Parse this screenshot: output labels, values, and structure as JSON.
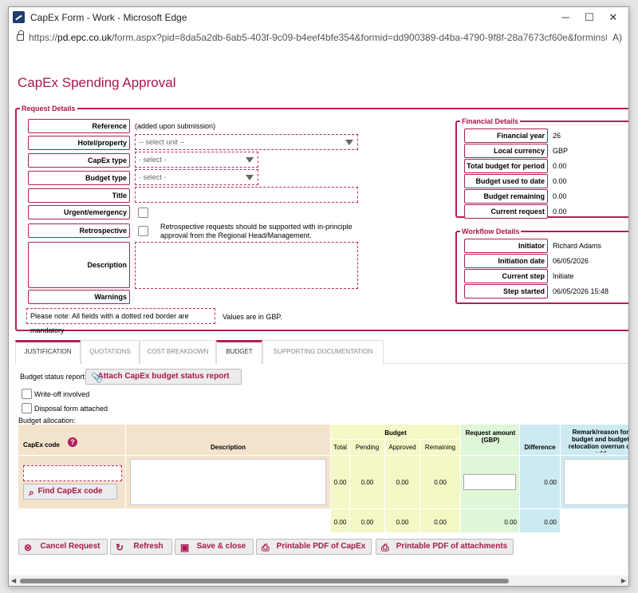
{
  "window": {
    "title": "CapEx Form - Work - Microsoft Edge",
    "minimize": "─",
    "maximize": "☐",
    "close": "✕"
  },
  "address": {
    "protocol": "https://",
    "host": "pd.epc.co.uk",
    "path": "/form.aspx?pid=8da5a2db-6ab5-403f-9c09-b4eef4bfe354&formid=dd900389-d4ba-4790-9f8f-28a7673cf60e&forminstid=&wfi...",
    "read_aloud": "A)"
  },
  "page": {
    "title": "CapEx Spending Approval"
  },
  "request": {
    "legend": "Request Details",
    "labels": {
      "reference": "Reference",
      "hotel": "Hotel/property",
      "capex_type": "CapEx type",
      "budget_type": "Budget type",
      "title": "Title",
      "urgent": "Urgent/emergency",
      "retrospective": "Retrospective",
      "description": "Description",
      "warnings": "Warnings"
    },
    "reference_value": "(added upon submission)",
    "hotel_placeholder": "-- select unit --",
    "capex_type_placeholder": "- select -",
    "budget_type_placeholder": "- select -",
    "retro_note": "Retrospective requests should be supported with in-principle approval from the Regional Head/Management.",
    "mandatory_note": "Please note: All fields with a dotted red border are mandatory",
    "currency_note": "Values are in GBP."
  },
  "financial": {
    "legend": "Financial Details",
    "rows": [
      {
        "label": "Financial year",
        "value": "26"
      },
      {
        "label": "Local currency",
        "value": "GBP"
      },
      {
        "label": "Total budget for period",
        "value": "0.00"
      },
      {
        "label": "Budget used to date",
        "value": "0.00"
      },
      {
        "label": "Budget remaining",
        "value": "0.00"
      },
      {
        "label": "Current request",
        "value": "0.00"
      }
    ]
  },
  "workflow": {
    "legend": "Workflow Details",
    "rows": [
      {
        "label": "Initiator",
        "value": "Richard Adams"
      },
      {
        "label": "Initiation date",
        "value": "06/05/2026"
      },
      {
        "label": "Current step",
        "value": "Initiate"
      },
      {
        "label": "Step started",
        "value": "06/05/2026 15:48"
      }
    ]
  },
  "tabs": [
    "JUSTIFICATION",
    "QUOTATIONS",
    "COST BREAKDOWN",
    "BUDGET",
    "SUPPORTING DOCUMENTATION"
  ],
  "budget_section": {
    "status_label": "Budget status report:",
    "attach_button": "Attach CapEx budget status report",
    "writeoff_label": "Write-off involved",
    "disposal_label": "Disposal form attached",
    "allocation_label": "Budget allocation:",
    "columns": {
      "capex_code": "CapEx code",
      "description": "Description",
      "budget": "Budget",
      "total": "Total",
      "pending": "Pending",
      "approved": "Approved",
      "remaining": "Remaining",
      "request_amount": "Request amount (GBP)",
      "difference": "Difference",
      "remark": "Remark/reason for budget and budget relocation overrun or add"
    },
    "find_button": "Find CapEx code",
    "row_values": [
      "0.00",
      "0.00",
      "0.00",
      "0.00",
      "0.00"
    ],
    "totals": [
      "0.00",
      "0.00",
      "0.00",
      "0.00",
      "0.00",
      "0.00"
    ]
  },
  "footer_buttons": {
    "cancel": "Cancel Request",
    "refresh": "Refresh",
    "save": "Save & close",
    "pdf_capex": "Printable PDF of CapEx",
    "pdf_attach": "Printable PDF of attachments"
  },
  "colors": {
    "accent": "#a8174f",
    "budget_bg": "#f4f7c6",
    "request_bg": "#dff6d8",
    "difference_bg": "#cdeaf2",
    "code_bg": "#f4e3cc"
  }
}
